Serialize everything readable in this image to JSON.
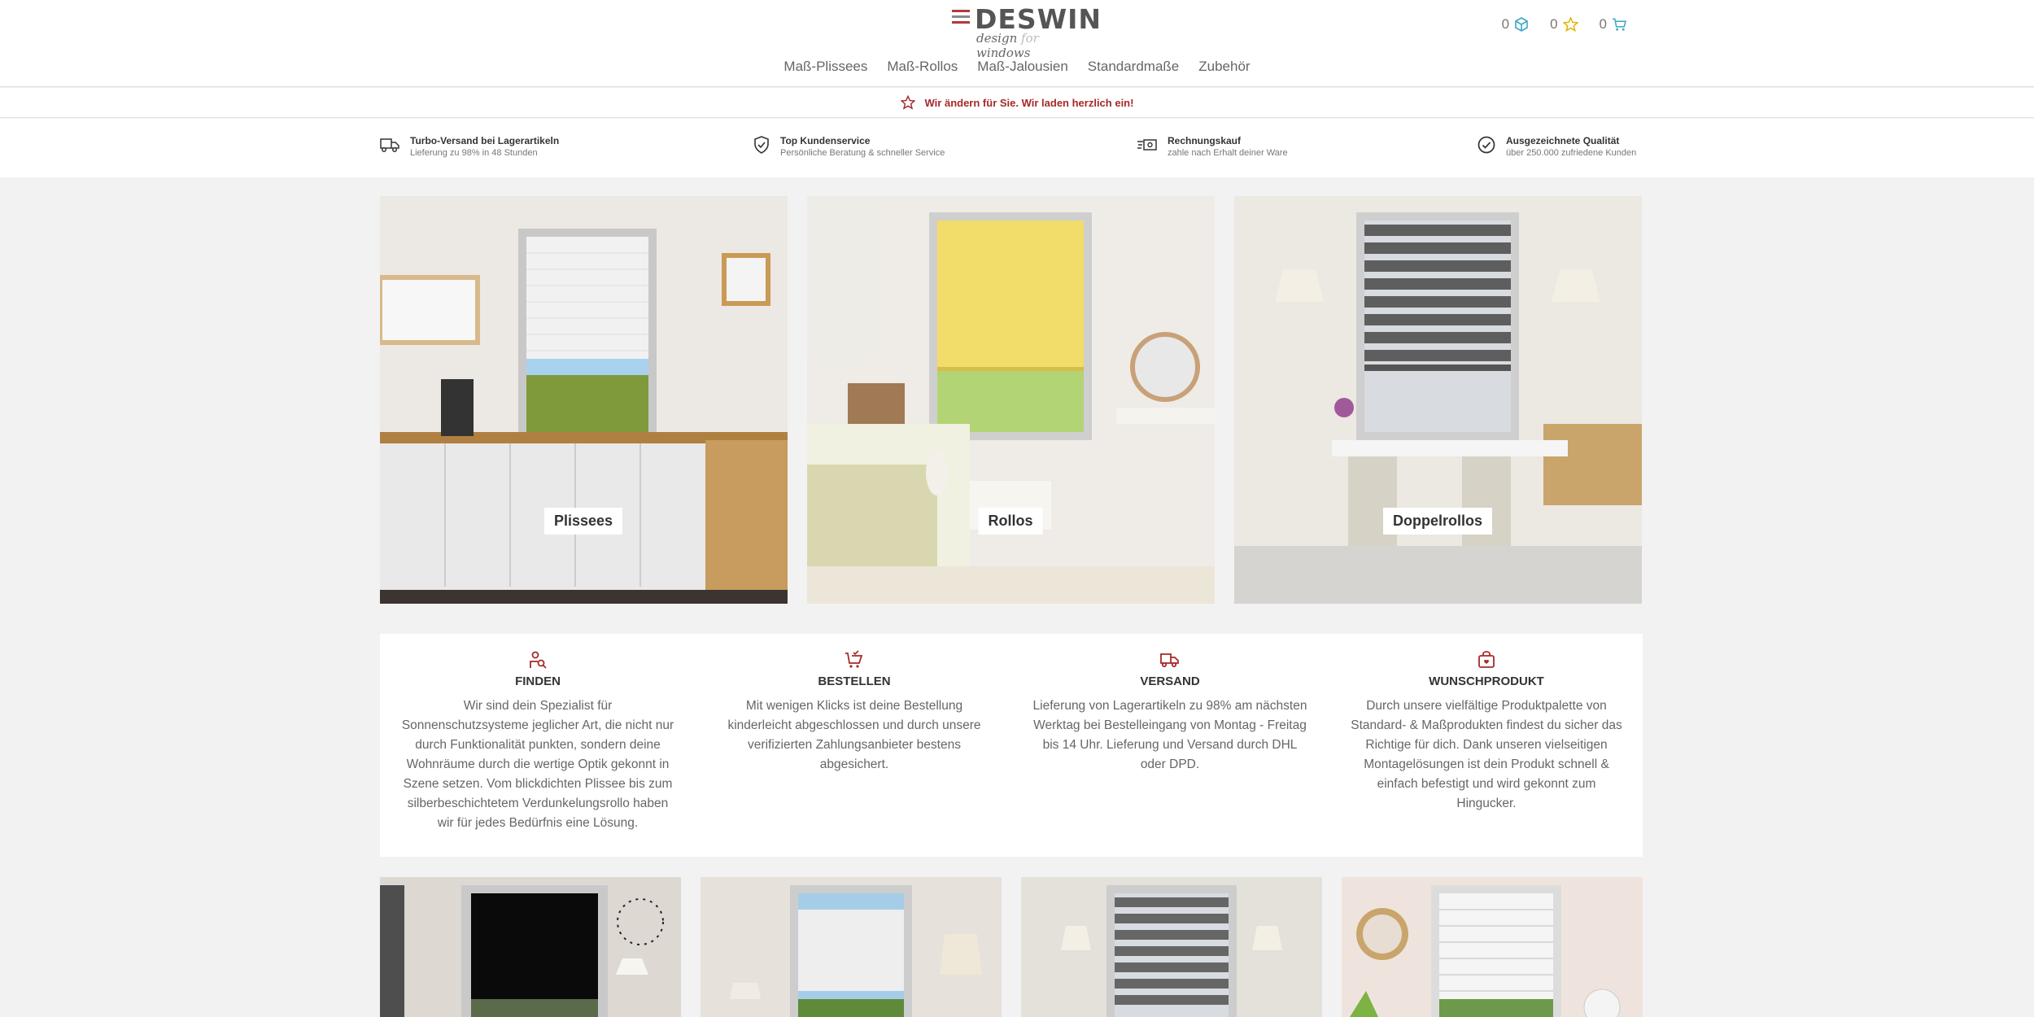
{
  "brand": {
    "name": "DESWIN",
    "tagline_a": "design",
    "tagline_b": "for",
    "tagline_c": "windows"
  },
  "header": {
    "counters": [
      {
        "value": "0",
        "icon": "box-icon",
        "color": "#3aa6c9"
      },
      {
        "value": "0",
        "icon": "star-icon",
        "color": "#e2b400"
      },
      {
        "value": "0",
        "icon": "cart-icon",
        "color": "#3aa6c9"
      }
    ]
  },
  "nav": [
    "Maß-Plissees",
    "Maß-Rollos",
    "Maß-Jalousien",
    "Standardmaße",
    "Zubehör"
  ],
  "notice": {
    "text": "Wir ändern für Sie. Wir laden herzlich ein!",
    "icon": "star-outline-icon",
    "color": "#a52a2a"
  },
  "usps": [
    {
      "title": "Turbo-Versand bei Lagerartikeln",
      "sub": "Lieferung zu 98% in 48 Stunden",
      "icon": "delivery-truck-icon"
    },
    {
      "title": "Top Kundenservice",
      "sub": "Persönliche Beratung & schneller Service",
      "icon": "shield-check-icon"
    },
    {
      "title": "Rechnungskauf",
      "sub": "zahle nach Erhalt deiner Ware",
      "icon": "invoice-money-icon"
    },
    {
      "title": "Ausgezeichnete Qualität",
      "sub": "über 250.000 zufriedene Kunden",
      "icon": "check-circle-icon"
    }
  ],
  "categories": [
    {
      "label": "Plissees"
    },
    {
      "label": "Rollos"
    },
    {
      "label": "Doppelrollos"
    }
  ],
  "features": [
    {
      "title": "FINDEN",
      "icon": "search-person-icon",
      "text": "Wir sind dein Spezialist für Sonnenschutzsysteme jeglicher Art, die nicht nur durch Funktionalität punkten, sondern deine Wohnräume durch die wertige Optik gekonnt in Szene setzen. Vom blickdichten Plissee bis zum silberbeschichtetem Verdunkelungsrollo haben wir für jedes Bedürfnis eine Lösung."
    },
    {
      "title": "BESTELLEN",
      "icon": "cart-check-icon",
      "text": "Mit wenigen Klicks ist deine Bestellung kinderleicht abgeschlossen und durch unsere verifizierten Zahlungsanbieter bestens abgesichert."
    },
    {
      "title": "VERSAND",
      "icon": "delivery-icon",
      "text": "Lieferung von Lagerartikeln zu 98% am nächsten Werktag bei Bestelleingang von Montag - Freitag bis 14 Uhr. Lieferung und Versand durch DHL oder DPD."
    },
    {
      "title": "WUNSCHPRODUKT",
      "icon": "gift-heart-icon",
      "text": "Durch unsere vielfältige Produktpalette von Standard- & Maßprodukten findest du sicher das Richtige für dich. Dank unseren vielseitigen Montagelösungen ist dein Produkt schnell & einfach befestigt und wird gekonnt zum Hingucker."
    }
  ],
  "colors": {
    "accent": "#a52a2a",
    "background": "#f2f2f2"
  }
}
